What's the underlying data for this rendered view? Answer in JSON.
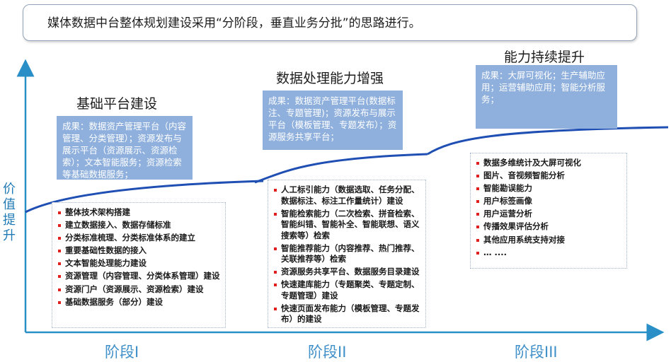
{
  "intro": "媒体数据中台整体规划建设采用“分阶段，垂直业务分批”的思路进行。",
  "axis": {
    "y_label": "价值提升",
    "y_label_chars": [
      "价",
      "值",
      "提",
      "升"
    ]
  },
  "phases": [
    {
      "label": "阶段I",
      "title": "基础平台建设",
      "result": "成果：数据资产管理平台（内容管理、分类管理）；资源发布与展示平台（资源展示、资源检索）；文本智能服务；资源检索等基础数据服务；",
      "items": [
        "整体技术架构搭建",
        "建立数据接入、数据存储标准",
        "分类标准梳理、分类标准体系的建立",
        "重要基础性数据的接入",
        "文本智能处理能力建设",
        "资源管理（内容管理、分类体系管理）建设",
        "资源门户（资源展示、资源检索）建设",
        "基础数据服务（部分）建设"
      ]
    },
    {
      "label": "阶段II",
      "title": "数据处理能力增强",
      "result": "成果：数据资产管理平台(数据标注、专题管理)；资源发布与展示平台（模板管理、专题发布）；资源服务共享平台；",
      "items": [
        "人工标引能力（数据选取、任务分配、数据标注、标注工作量统计）建设",
        "智能检索能力（二次检索、拼音检索、智能纠错、智能补全、智能联想、语义搜索等）检索",
        "智能推荐能力（内容推荐、热门推荐、关联推荐等）检索",
        "资源服务共享平台、数据服务目录建设",
        "快速建库能力（专题聚类、专题定制、专题管理）建设",
        "快速页面发布能力（模板管理、专题发布）的建设"
      ]
    },
    {
      "label": "阶段III",
      "title": "能力持续提升",
      "result": "成果：大屏可视化；生产辅助应用；运营辅助应用；智能分析服务；",
      "items": [
        "数据多维统计及大屏可视化",
        "图片、音视频智能分析",
        "智能勘误能力",
        "用户标签画像",
        "用户运营分析",
        "传播效果评估分析",
        "其他应用系统支持对接",
        "… ...."
      ]
    }
  ],
  "colors": {
    "axis": "#2a8fc6",
    "curve": "#1f4fb3",
    "result_box": "#8fb0dd",
    "bullet": "#e02020",
    "phase_label": "#3f8fc8"
  }
}
